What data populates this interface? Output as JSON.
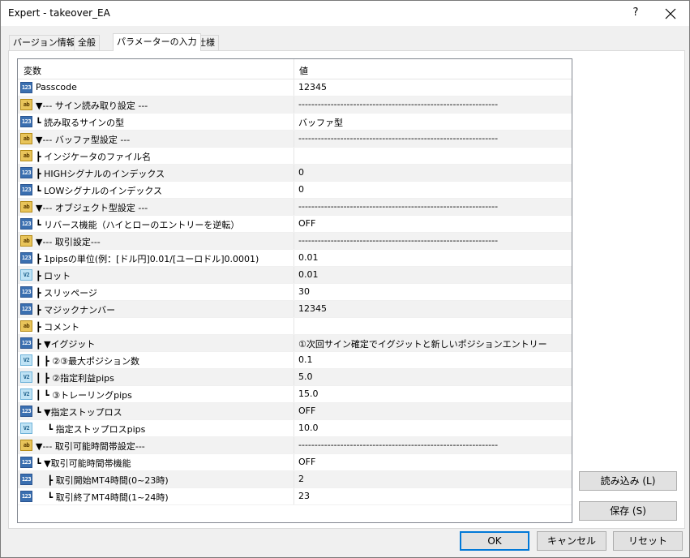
{
  "window": {
    "title": "Expert - takeover_EA",
    "help_glyph": "?"
  },
  "tabs": [
    {
      "label": "バージョン情報"
    },
    {
      "label": "全般"
    },
    {
      "label": "パラメーターの入力",
      "active": true
    },
    {
      "label": "仕様"
    }
  ],
  "grid": {
    "col_name": "変数",
    "col_value": "値",
    "rows": [
      {
        "type": "int",
        "name": "Passcode",
        "value": "12345"
      },
      {
        "type": "str",
        "name": "▼--- サイン読み取り設定 ---",
        "value": "--------------------------------------------------------------"
      },
      {
        "type": "int",
        "name": "┗ 読み取るサインの型",
        "value": "バッファ型"
      },
      {
        "type": "str",
        "name": "▼--- バッファ型設定 ---",
        "value": "--------------------------------------------------------------"
      },
      {
        "type": "str",
        "name": "┣ インジケータのファイル名",
        "value": ""
      },
      {
        "type": "int",
        "name": "┣ HIGHシグナルのインデックス",
        "value": "0"
      },
      {
        "type": "int",
        "name": "┗ LOWシグナルのインデックス",
        "value": "0"
      },
      {
        "type": "str",
        "name": "▼--- オブジェクト型設定 ---",
        "value": "--------------------------------------------------------------"
      },
      {
        "type": "int",
        "name": "┗ リバース機能（ハイとローのエントリーを逆転）",
        "value": "OFF"
      },
      {
        "type": "str",
        "name": "▼--- 取引設定---",
        "value": "--------------------------------------------------------------"
      },
      {
        "type": "int",
        "name": "┣ 1pipsの単位(例：[ドル円]0.01/[ユーロドル]0.0001)",
        "value": "0.01"
      },
      {
        "type": "dbl",
        "name": "┣ ロット",
        "value": "0.01"
      },
      {
        "type": "int",
        "name": "┣ スリッページ",
        "value": "30"
      },
      {
        "type": "int",
        "name": "┣ マジックナンバー",
        "value": "12345"
      },
      {
        "type": "str",
        "name": "┣ コメント",
        "value": ""
      },
      {
        "type": "int",
        "name": "┣ ▼イグジット",
        "value": "①次回サイン確定でイグジットと新しいポジションエントリー"
      },
      {
        "type": "dbl",
        "name": "┃ ┣ ②③最大ポジション数",
        "value": "0.1"
      },
      {
        "type": "dbl",
        "name": "┃ ┣ ②指定利益pips",
        "value": "5.0"
      },
      {
        "type": "dbl",
        "name": "┃ ┗ ③トレーリングpips",
        "value": "15.0"
      },
      {
        "type": "int",
        "name": "┗ ▼指定ストップロス",
        "value": "OFF"
      },
      {
        "type": "dbl",
        "name": "　 ┗ 指定ストップロスpips",
        "value": "10.0"
      },
      {
        "type": "str",
        "name": "▼--- 取引可能時間帯設定---",
        "value": "--------------------------------------------------------------"
      },
      {
        "type": "int",
        "name": "┗ ▼取引可能時間帯機能",
        "value": "OFF"
      },
      {
        "type": "int",
        "name": "　 ┣ 取引開始MT4時間(0~23時)",
        "value": "2"
      },
      {
        "type": "int",
        "name": "　 ┗ 取引終了MT4時間(1~24時)",
        "value": "23"
      }
    ]
  },
  "icon_labels": {
    "int": "123",
    "str": "ab",
    "dbl": "V2"
  },
  "buttons": {
    "load": "読み込み (L)",
    "save": "保存 (S)",
    "ok": "OK",
    "cancel": "キャンセル",
    "reset": "リセット"
  }
}
